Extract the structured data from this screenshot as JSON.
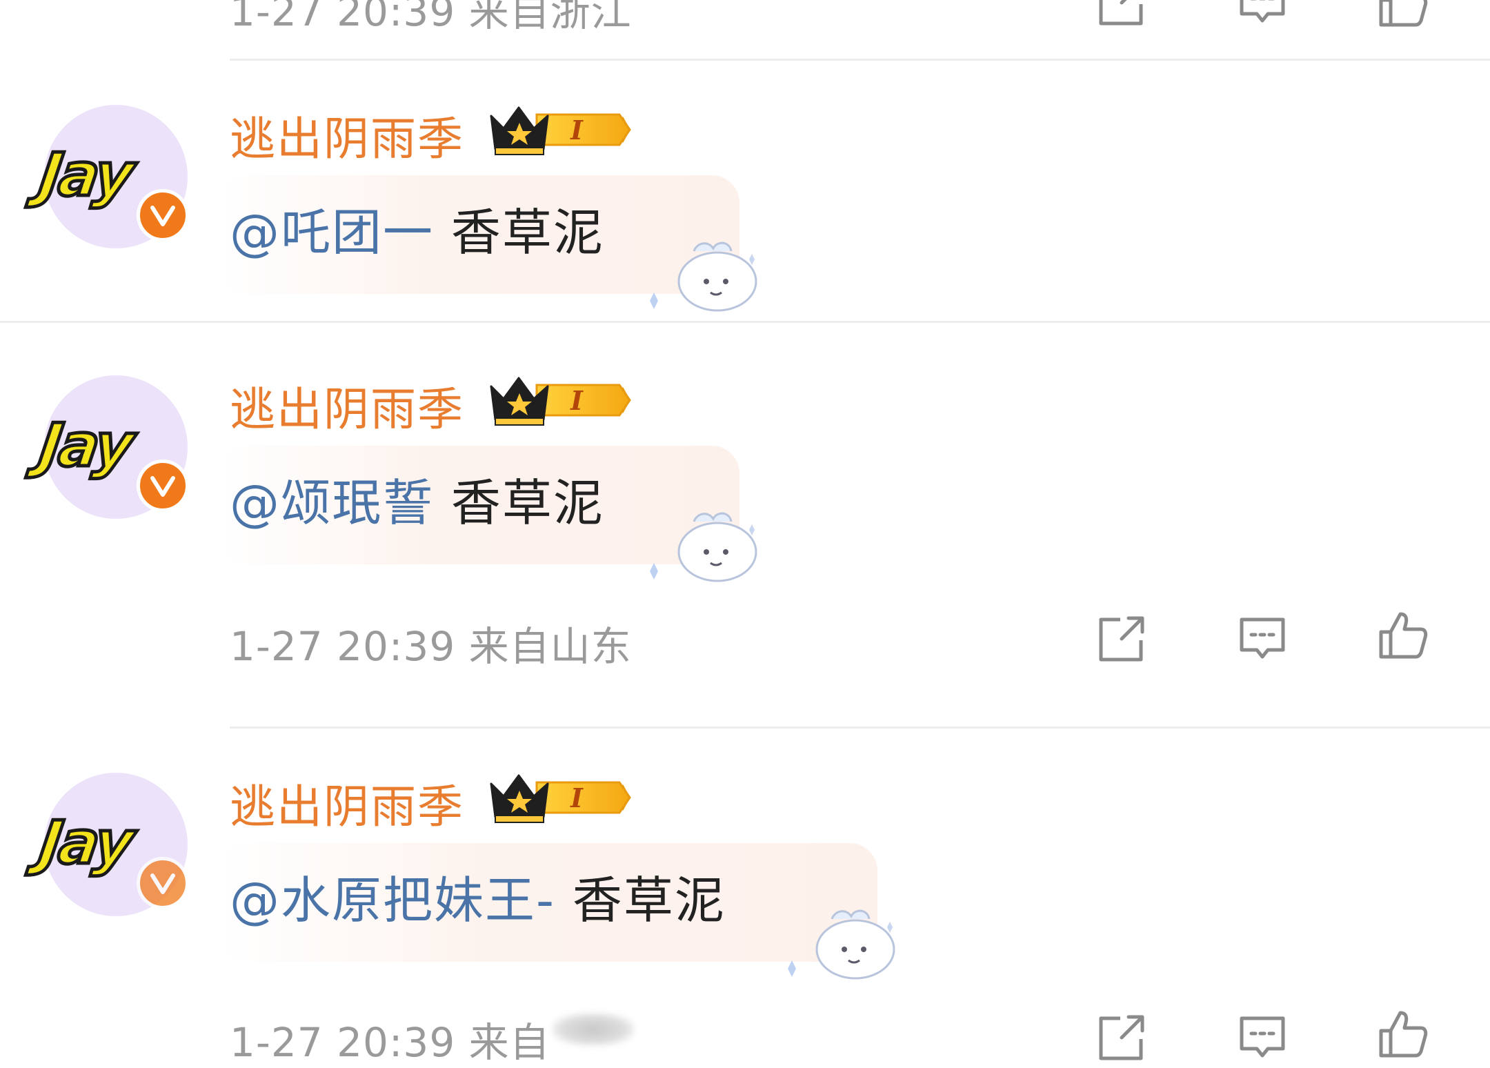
{
  "top_row": {
    "meta": "1-27 20:39 来自浙江"
  },
  "comments": [
    {
      "username": "逃出阴雨季",
      "avatar_text": "Jay",
      "mention": "@吒团一",
      "text": "香草泥",
      "badge_level": "I"
    },
    {
      "username": "逃出阴雨季",
      "avatar_text": "Jay",
      "mention": "@颂珉誓",
      "text": "香草泥",
      "badge_level": "I",
      "meta": "1-27 20:39 来自山东"
    },
    {
      "username": "逃出阴雨季",
      "avatar_text": "Jay",
      "mention": "@水原把妹王-",
      "text": "香草泥",
      "badge_level": "I",
      "meta": "1-27 20:39 来自"
    }
  ],
  "icons": {
    "share": "share-icon",
    "comment": "comment-icon",
    "like": "like-icon",
    "verified": "verified-v-icon",
    "crown": "crown-icon"
  },
  "colors": {
    "username": "#e87c2f",
    "mention": "#4a74a8",
    "meta": "#9a9a9a",
    "verified": "#f07a1a",
    "avatar_bg": "#ece3fa"
  }
}
